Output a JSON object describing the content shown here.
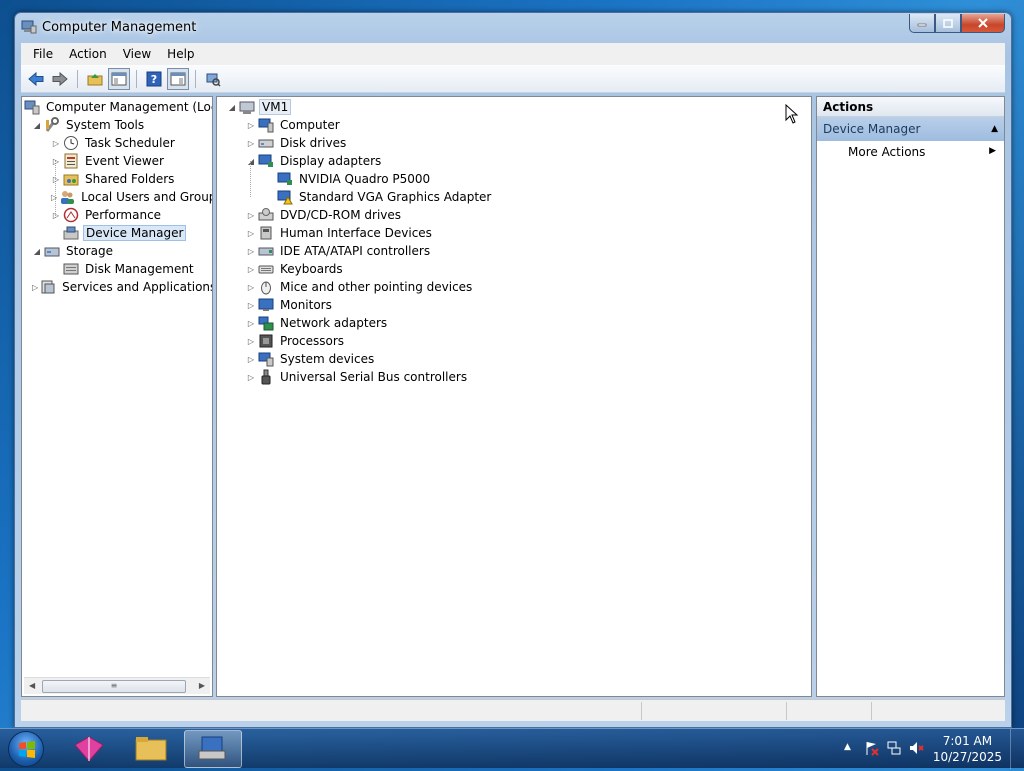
{
  "window": {
    "title": "Computer Management"
  },
  "menu": [
    "File",
    "Action",
    "View",
    "Help"
  ],
  "left_tree": {
    "root": "Computer Management (Local",
    "system_tools": "System Tools",
    "task_scheduler": "Task Scheduler",
    "event_viewer": "Event Viewer",
    "shared_folders": "Shared Folders",
    "local_users": "Local Users and Groups",
    "performance": "Performance",
    "device_manager": "Device Manager",
    "storage": "Storage",
    "disk_management": "Disk Management",
    "services": "Services and Applications"
  },
  "device_tree": {
    "root": "VM1",
    "items": [
      "Computer",
      "Disk drives",
      "Display adapters",
      "NVIDIA Quadro P5000",
      "Standard VGA Graphics Adapter",
      "DVD/CD-ROM drives",
      "Human Interface Devices",
      "IDE ATA/ATAPI controllers",
      "Keyboards",
      "Mice and other pointing devices",
      "Monitors",
      "Network adapters",
      "Processors",
      "System devices",
      "Universal Serial Bus controllers"
    ]
  },
  "actions": {
    "header": "Actions",
    "section": "Device Manager",
    "more": "More Actions"
  },
  "taskbar": {
    "time": "7:01 AM",
    "date": "10/27/2025"
  },
  "icons": {
    "back": "back-arrow-icon",
    "forward": "forward-arrow-icon",
    "up": "up-folder-icon",
    "help": "help-icon",
    "warning": "warning-icon"
  }
}
